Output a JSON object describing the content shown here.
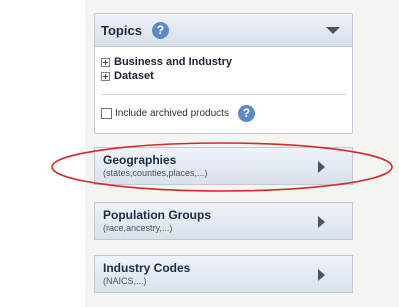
{
  "topics": {
    "title": "Topics",
    "help_symbol": "?",
    "items": [
      {
        "label": "Business and Industry"
      },
      {
        "label": "Dataset"
      }
    ],
    "archive_label": "Include archived products",
    "archive_checked": false
  },
  "nav_cards": [
    {
      "title": "Geographies",
      "subtitle": "(states,counties,places,...)"
    },
    {
      "title": "Population Groups",
      "subtitle": "(race,ancestry,...)"
    },
    {
      "title": "Industry Codes",
      "subtitle": "(NAICS,...)"
    }
  ],
  "colors": {
    "annotation_ellipse": "#d42a2a",
    "help_icon": "#5b8ac6",
    "panel_header": "#d7dfea"
  }
}
